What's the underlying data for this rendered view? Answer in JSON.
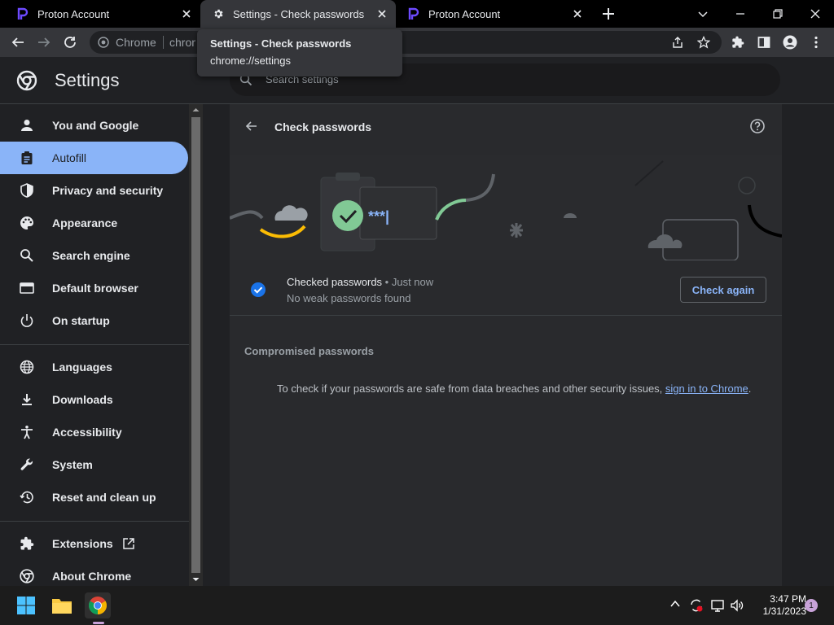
{
  "tabs": [
    {
      "title": "Proton Account",
      "active": false
    },
    {
      "title": "Settings - Check passwords",
      "active": true
    },
    {
      "title": "Proton Account",
      "active": false
    }
  ],
  "omnibox": {
    "site_label": "Chrome",
    "url_partial": "chrome"
  },
  "tooltip": {
    "title": "Settings - Check passwords",
    "url": "chrome://settings"
  },
  "settings": {
    "title": "Settings",
    "search_placeholder": "Search settings"
  },
  "sidebar": {
    "items": [
      {
        "label": "You and Google",
        "icon": "person-icon"
      },
      {
        "label": "Autofill",
        "icon": "clipboard-icon",
        "selected": true
      },
      {
        "label": "Privacy and security",
        "icon": "shield-icon"
      },
      {
        "label": "Appearance",
        "icon": "palette-icon"
      },
      {
        "label": "Search engine",
        "icon": "search-icon"
      },
      {
        "label": "Default browser",
        "icon": "browser-icon"
      },
      {
        "label": "On startup",
        "icon": "power-icon"
      },
      {
        "label": "Languages",
        "icon": "globe-icon"
      },
      {
        "label": "Downloads",
        "icon": "download-icon"
      },
      {
        "label": "Accessibility",
        "icon": "accessibility-icon"
      },
      {
        "label": "System",
        "icon": "wrench-icon"
      },
      {
        "label": "Reset and clean up",
        "icon": "history-icon"
      },
      {
        "label": "Extensions",
        "icon": "puzzle-icon"
      },
      {
        "label": "About Chrome",
        "icon": "chrome-icon"
      }
    ]
  },
  "main": {
    "title": "Check passwords",
    "banner_password": "***|",
    "status": {
      "title": "Checked passwords",
      "separator": " • ",
      "time": "Just now",
      "detail": "No weak passwords found",
      "button": "Check again"
    },
    "compromised_title": "Compromised passwords",
    "message": "To check if your passwords are safe from data breaches and other security issues, ",
    "message_link": "sign in to Chrome",
    "message_end": "."
  },
  "taskbar": {
    "time": "3:47 PM",
    "date": "1/31/2023",
    "notifications": "1"
  },
  "colors": {
    "accent": "#8ab4f8",
    "background": "#202124",
    "card": "#292a2d",
    "check_green": "#81c995",
    "proton_purple": "#6d4aff"
  }
}
